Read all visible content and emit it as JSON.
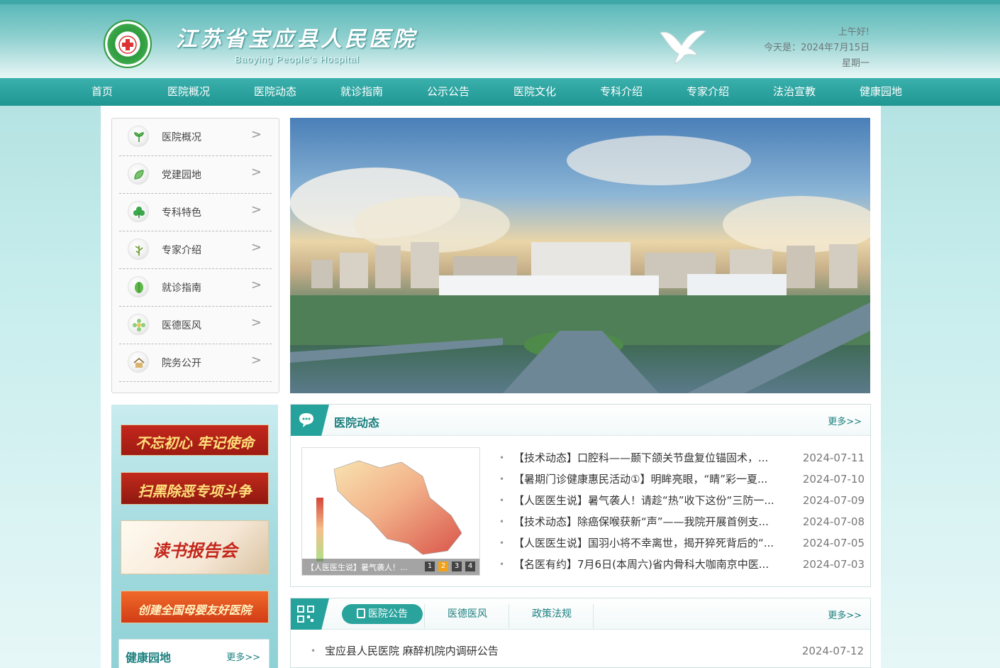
{
  "header": {
    "title": "江苏省宝应县人民医院",
    "subtitle": "Baoying People's Hospital",
    "greeting": "上午好!",
    "date_line": "今天是：2024年7月15日",
    "weekday": "星期一",
    "brand_color": "#2aa39d",
    "icons": {
      "logo": "hospital-logo-icon",
      "dove": "dove-icon"
    }
  },
  "nav": {
    "items": [
      "首页",
      "医院概况",
      "医院动态",
      "就诊指南",
      "公示公告",
      "医院文化",
      "专科介绍",
      "专家介绍",
      "法治宣教",
      "健康园地"
    ]
  },
  "side_menu": {
    "items": [
      {
        "label": "医院概况",
        "icon": "sprout-icon"
      },
      {
        "label": "党建园地",
        "icon": "leaf-icon"
      },
      {
        "label": "专科特色",
        "icon": "clover-icon"
      },
      {
        "label": "专家介绍",
        "icon": "plant-icon"
      },
      {
        "label": "就诊指南",
        "icon": "leaf-round-icon"
      },
      {
        "label": "医德医风",
        "icon": "flower-icon"
      },
      {
        "label": "院务公开",
        "icon": "house-icon"
      }
    ],
    "arrow": ">"
  },
  "promo": {
    "banners": [
      "不忘初心 牢记使命",
      "扫黑除恶专项斗争",
      "读书报告会",
      "创建全国母婴友好医院"
    ],
    "health_title": "健康园地",
    "health_more": "更多>>"
  },
  "news": {
    "title": "医院动态",
    "more": "更多>>",
    "thumb_caption": "【人医医生说】暑气袭人！...",
    "thumb_pages": [
      "1",
      "2",
      "3",
      "4"
    ],
    "thumb_active_page": 2,
    "items": [
      {
        "title": "【技术动态】口腔科——颞下颌关节盘复位锚固术，...",
        "date": "2024-07-11"
      },
      {
        "title": "【暑期门诊健康惠民活动①】明眸亮眼，“睛”彩一夏...",
        "date": "2024-07-10"
      },
      {
        "title": "【人医医生说】暑气袭人！请趁“热”收下这份“三防一...",
        "date": "2024-07-09"
      },
      {
        "title": "【技术动态】除癌保喉获新“声”——我院开展首例支...",
        "date": "2024-07-08"
      },
      {
        "title": "【人医医生说】国羽小将不幸离世，揭开猝死背后的“...",
        "date": "2024-07-05"
      },
      {
        "title": "【名医有约】7月6日(本周六)省内骨科大咖南京中医...",
        "date": "2024-07-03"
      }
    ]
  },
  "notice": {
    "tabs": [
      "医院公告",
      "医德医风",
      "政策法规"
    ],
    "active_tab": 0,
    "more": "更多>>",
    "items": [
      {
        "title": "宝应县人民医院 麻醉机院内调研公告",
        "date": "2024-07-12"
      }
    ]
  }
}
